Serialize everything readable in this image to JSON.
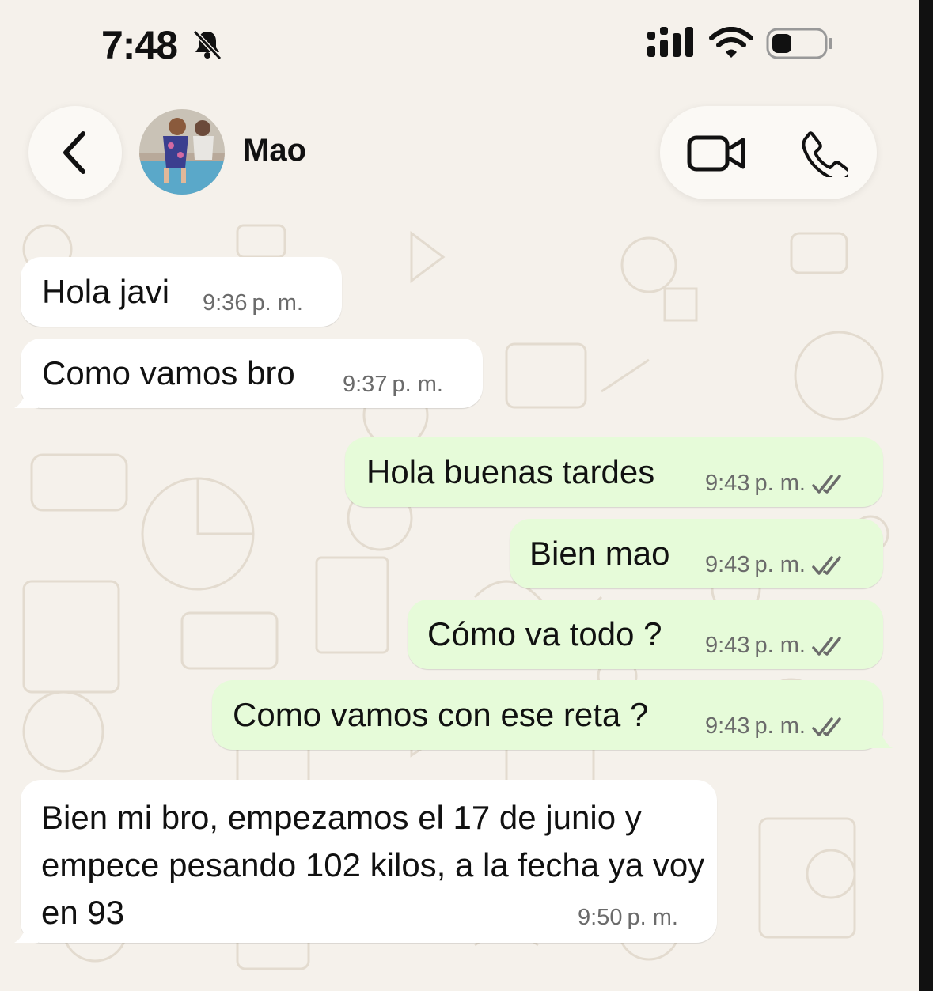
{
  "status_bar": {
    "time": "7:48",
    "icons": [
      "bell-slash-icon",
      "signal-icon",
      "wifi-icon",
      "battery-icon"
    ]
  },
  "header": {
    "contact_name": "Mao",
    "icons": [
      "chevron-left-icon",
      "video-call-icon",
      "phone-call-icon"
    ]
  },
  "colors": {
    "background": "#f5f1eb",
    "incoming_bubble": "#ffffff",
    "outgoing_bubble": "#e6fbd9",
    "tick_color": "#6b6b6b"
  },
  "messages": [
    {
      "direction": "incoming",
      "text": "Hola javi",
      "time": "9:36",
      "ampm": "p. m."
    },
    {
      "direction": "incoming",
      "text": "Como vamos bro",
      "time": "9:37",
      "ampm": "p. m."
    },
    {
      "direction": "outgoing",
      "text": "Hola buenas tardes",
      "time": "9:43",
      "ampm": "p. m.",
      "status": "read-double-check"
    },
    {
      "direction": "outgoing",
      "text": "Bien mao",
      "time": "9:43",
      "ampm": "p. m.",
      "status": "read-double-check"
    },
    {
      "direction": "outgoing",
      "text": "Cómo va todo ?",
      "time": "9:43",
      "ampm": "p. m.",
      "status": "read-double-check"
    },
    {
      "direction": "outgoing",
      "text": "Como vamos con ese reta ?",
      "time": "9:43",
      "ampm": "p. m.",
      "status": "read-double-check"
    },
    {
      "direction": "incoming",
      "text": "Bien mi bro, empezamos el 17 de junio y empece pesando 102 kilos, a la fecha ya voy en 93",
      "time": "9:50",
      "ampm": "p. m."
    }
  ]
}
